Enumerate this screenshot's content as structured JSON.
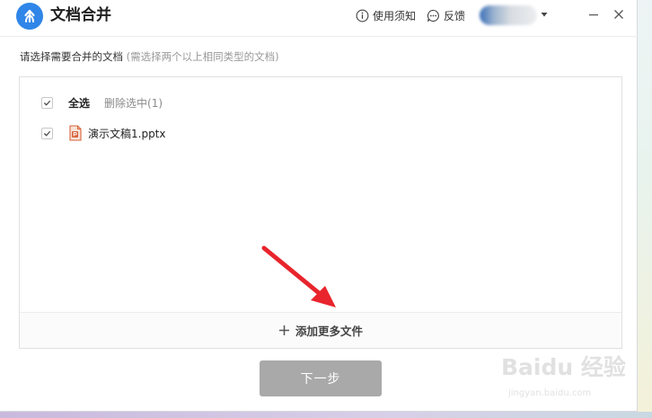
{
  "window": {
    "title": "文档合并"
  },
  "titlebar": {
    "help_label": "使用须知",
    "feedback_label": "反馈"
  },
  "instruction": {
    "main": "请选择需要合并的文档",
    "hint": "(需选择两个以上相同类型的文档)"
  },
  "file_list": {
    "select_all_label": "全选",
    "select_all_checked": true,
    "delete_selected_label": "删除选中(1)",
    "files": [
      {
        "name": "演示文稿1.pptx",
        "type": "pptx",
        "checked": true
      }
    ],
    "add_more_label": "添加更多文件"
  },
  "footer": {
    "next_label": "下一步"
  },
  "watermark": {
    "text": "Baidu 经验",
    "url": "jingyan.baidu.com"
  },
  "colors": {
    "brand_blue": "#2f86e8",
    "annotation_red": "#e8242c",
    "button_disabled": "#a9a9a9",
    "pptx_orange": "#d9623a"
  }
}
